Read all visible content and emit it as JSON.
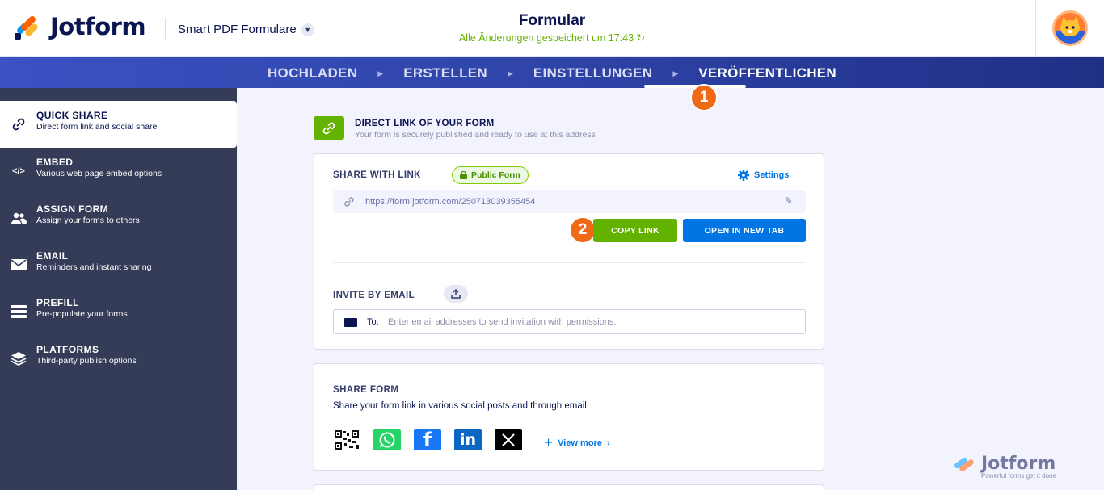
{
  "header": {
    "brand": "Jotform",
    "form_type": "Smart PDF Formulare",
    "title": "Formular",
    "status": "Alle Änderungen gespeichert um 17:43"
  },
  "nav": {
    "steps": [
      "HOCHLADEN",
      "ERSTELLEN",
      "EINSTELLUNGEN",
      "VERÖFFENTLICHEN"
    ],
    "active_step": "VERÖFFENTLICHEN"
  },
  "badges": {
    "step1": "1",
    "step2": "2"
  },
  "sidebar": {
    "items": [
      {
        "title": "QUICK SHARE",
        "subtitle": "Direct form link and social share",
        "icon": "link-icon",
        "active": true
      },
      {
        "title": "EMBED",
        "subtitle": "Various web page embed options",
        "icon": "code-icon",
        "active": false
      },
      {
        "title": "ASSIGN FORM",
        "subtitle": "Assign your forms to others",
        "icon": "users-icon",
        "active": false
      },
      {
        "title": "EMAIL",
        "subtitle": "Reminders and instant sharing",
        "icon": "envelope-icon",
        "active": false
      },
      {
        "title": "PREFILL",
        "subtitle": "Pre-populate your forms",
        "icon": "prefill-icon",
        "active": false
      },
      {
        "title": "PLATFORMS",
        "subtitle": "Third-party publish options",
        "icon": "layers-icon",
        "active": false
      }
    ]
  },
  "direct_link": {
    "title": "DIRECT LINK OF YOUR FORM",
    "subtitle": "Your form is securely published and ready to use at this address"
  },
  "share_link": {
    "label": "SHARE WITH LINK",
    "badge": "Public Form",
    "settings": "Settings",
    "url": "https://form.jotform.com/250713039355454",
    "copy_button": "COPY LINK",
    "open_button": "OPEN IN NEW TAB"
  },
  "invite": {
    "label": "INVITE BY EMAIL",
    "to_label": "To:",
    "placeholder": "Enter email addresses to send invitation with permissions."
  },
  "share_form": {
    "label": "SHARE FORM",
    "subtitle": "Share your form link in various social posts and through email.",
    "view_more": "View more",
    "socials": [
      "qr-code-icon",
      "whatsapp-icon",
      "facebook-icon",
      "linkedin-icon",
      "x-icon"
    ]
  },
  "watermark": {
    "brand": "Jotform",
    "tagline": "Powerful forms get it done"
  },
  "colors": {
    "accent_green": "#64b200",
    "accent_blue": "#0075e3",
    "navy": "#0a1551",
    "orange": "#ee6a16"
  }
}
